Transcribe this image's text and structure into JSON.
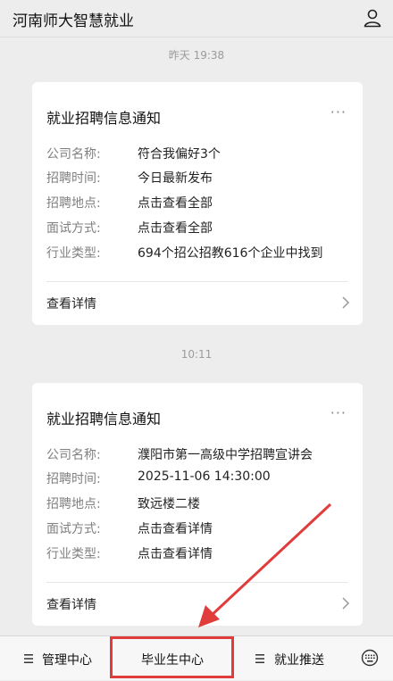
{
  "header": {
    "title": "河南师大智慧就业"
  },
  "messages": [
    {
      "time": "昨天 19:38",
      "card": {
        "title": "就业招聘信息通知",
        "more": "···",
        "rows": [
          {
            "label": "公司名称:",
            "value": "符合我偏好3个"
          },
          {
            "label": "招聘时间:",
            "value": "今日最新发布"
          },
          {
            "label": "招聘地点:",
            "value": "点击查看全部"
          },
          {
            "label": "面试方式:",
            "value": "点击查看全部"
          },
          {
            "label": "行业类型:",
            "value": "694个招公招教616个企业中找到"
          }
        ],
        "detail_label": "查看详情"
      }
    },
    {
      "time": "10:11",
      "card": {
        "title": "就业招聘信息通知",
        "more": "···",
        "rows": [
          {
            "label": "公司名称:",
            "value": "濮阳市第一高级中学招聘宣讲会"
          },
          {
            "label": "招聘时间:",
            "value": "2025-11-06 14:30:00"
          },
          {
            "label": "招聘地点:",
            "value": "致远楼二楼"
          },
          {
            "label": "面试方式:",
            "value": "点击查看详情"
          },
          {
            "label": "行业类型:",
            "value": "点击查看详情"
          }
        ],
        "detail_label": "查看详情"
      }
    }
  ],
  "bottom_menu": {
    "items": [
      {
        "label": "管理中心",
        "icon": "menu-icon"
      },
      {
        "label": "毕业生中心",
        "icon": ""
      },
      {
        "label": "就业推送",
        "icon": "menu-icon"
      }
    ],
    "keyboard_icon": "keyboard-icon"
  },
  "annotation": {
    "highlight_color": "#e03c3c"
  }
}
